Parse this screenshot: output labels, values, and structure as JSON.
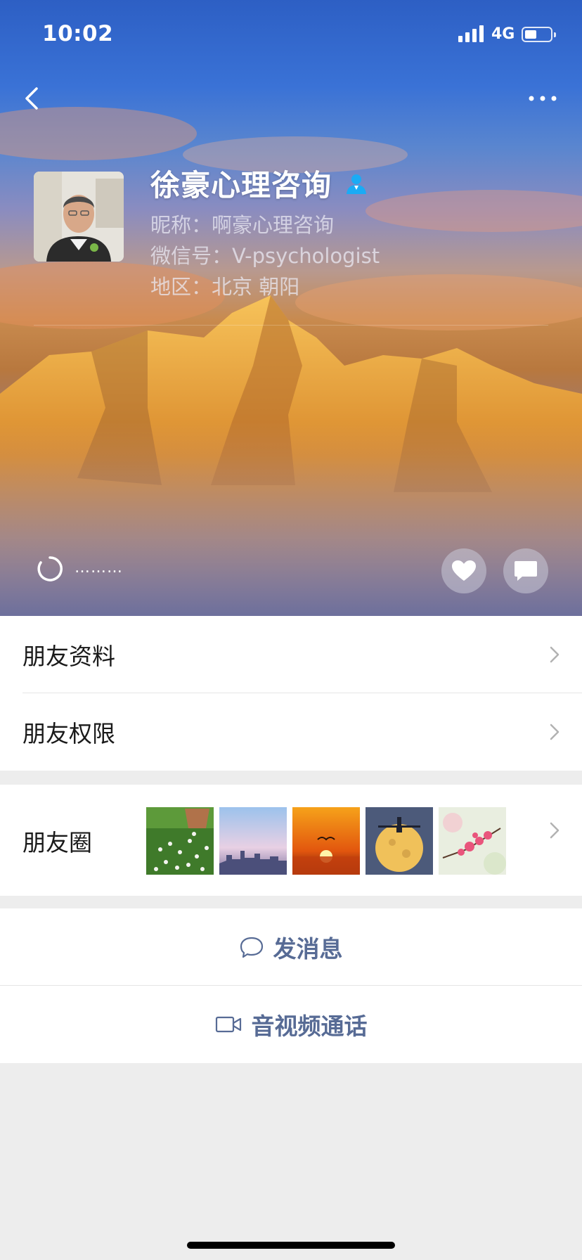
{
  "status_bar": {
    "time": "10:02",
    "network": "4G"
  },
  "profile": {
    "name": "徐豪心理咨询",
    "nickname": "昵称：啊豪心理咨询",
    "wechat_id": "微信号：V-psychologist",
    "region": "地区：北京 朝阳",
    "status_text": "………"
  },
  "menu": {
    "friend_info": "朋友资料",
    "friend_permissions": "朋友权限",
    "moments": "朋友圈"
  },
  "actions": {
    "send_message": "发消息",
    "video_call": "音视频通话"
  },
  "colors": {
    "link_blue": "#576b95",
    "verify_blue": "#1aabf5",
    "page_bg": "#ededed"
  },
  "icons": [
    "back-arrow-icon",
    "more-icon",
    "verified-badge-icon",
    "status-ring-icon",
    "heart-icon",
    "chat-bubble-icon",
    "chevron-right-icon",
    "message-bubble-icon",
    "video-camera-icon"
  ]
}
